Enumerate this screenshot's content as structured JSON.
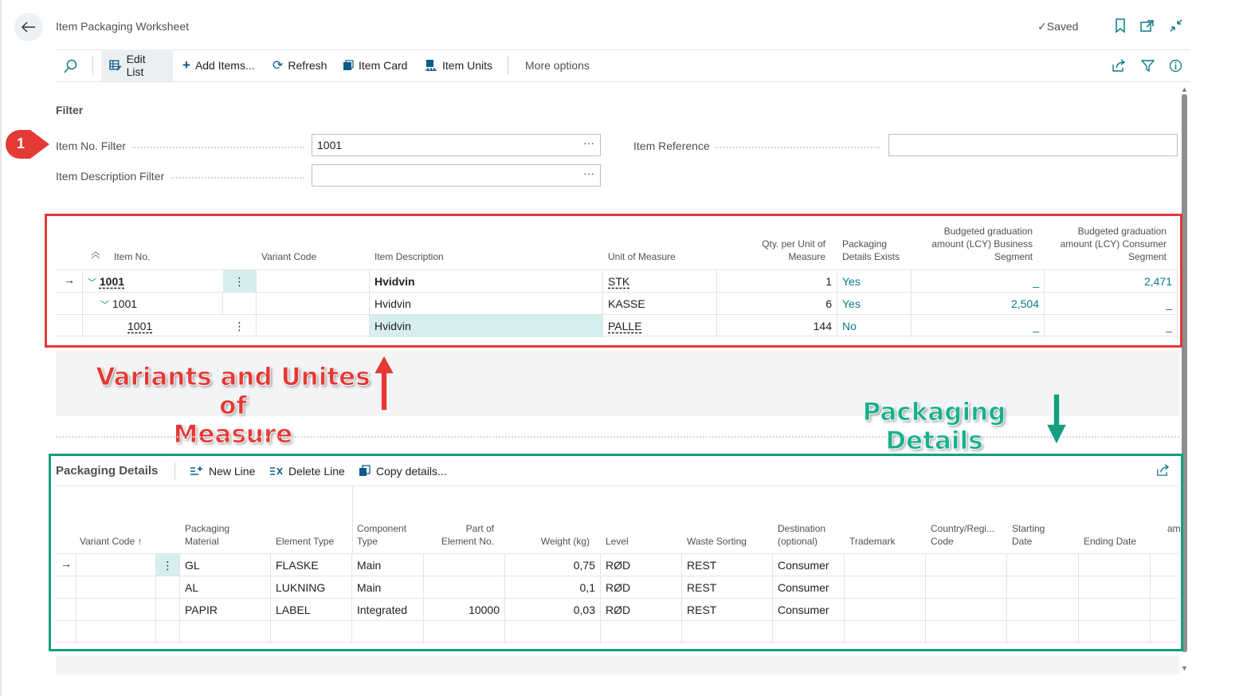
{
  "header": {
    "title": "Item Packaging Worksheet",
    "saved_label": "Saved"
  },
  "actions": {
    "edit_list": "Edit List",
    "add_items": "Add Items...",
    "refresh": "Refresh",
    "item_card": "Item Card",
    "item_units": "Item Units",
    "more_options": "More options"
  },
  "filter": {
    "section_label": "Filter",
    "item_no_label": "Item No. Filter",
    "item_no_value": "1001",
    "item_desc_label": "Item Description Filter",
    "item_desc_value": "",
    "item_ref_label": "Item Reference",
    "item_ref_value": "",
    "ellipsis": "···"
  },
  "badge": {
    "number": "1"
  },
  "item_grid": {
    "headers": {
      "item_no": "Item No.",
      "variant_code": "Variant Code",
      "item_description": "Item Description",
      "unit_of_measure": "Unit of Measure",
      "qty_line1": "Qty. per Unit of",
      "qty_line2": "Measure",
      "pack_line1": "Packaging",
      "pack_line2": "Details Exists",
      "bus_line1": "Budgeted graduation",
      "bus_line2": "amount (LCY) Business",
      "bus_line3": "Segment",
      "con_line1": "Budgeted graduation",
      "con_line2": "amount (LCY) Consumer",
      "con_line3": "Segment"
    },
    "rows": [
      {
        "item_no": "1001",
        "variant": "",
        "description": "Hvidvin",
        "uom": "STK",
        "qty": "1",
        "exists": "Yes",
        "business": "_",
        "consumer": "2,471"
      },
      {
        "item_no": "1001",
        "variant": "",
        "description": "Hvidvin",
        "uom": "KASSE",
        "qty": "6",
        "exists": "Yes",
        "business": "2,504",
        "consumer": "_"
      },
      {
        "item_no": "1001",
        "variant": "",
        "description": "Hvidvin",
        "uom": "PALLE",
        "qty": "144",
        "exists": "No",
        "business": "_",
        "consumer": "_"
      }
    ]
  },
  "annotations": {
    "variants_line1": "Variants and Unites of",
    "variants_line2": "Measure",
    "packaging": "Packaging Details"
  },
  "packaging": {
    "title": "Packaging Details",
    "new_line": "New Line",
    "delete_line": "Delete Line",
    "copy_details": "Copy details...",
    "headers": {
      "variant_code": "Variant Code ↑",
      "material_line1": "Packaging",
      "material_line2": "Material",
      "element_type": "Element Type",
      "component_line1": "Component",
      "component_line2": "Type",
      "part_line1": "Part of",
      "part_line2": "Element No.",
      "weight": "Weight (kg)",
      "level": "Level",
      "waste": "Waste Sorting",
      "dest_line1": "Destination",
      "dest_line2": "(optional)",
      "trademark": "Trademark",
      "country_line1": "Country/Regi...",
      "country_line2": "Code",
      "start_line1": "Starting",
      "start_line2": "Date",
      "ending": "Ending Date",
      "cut": "am"
    },
    "rows": [
      {
        "variant": "",
        "material": "GL",
        "element_type": "FLASKE",
        "component": "Main",
        "part_of": "",
        "weight": "0,75",
        "level": "RØD",
        "waste": "REST",
        "destination": "Consumer"
      },
      {
        "variant": "",
        "material": "AL",
        "element_type": "LUKNING",
        "component": "Main",
        "part_of": "",
        "weight": "0,1",
        "level": "RØD",
        "waste": "REST",
        "destination": "Consumer"
      },
      {
        "variant": "",
        "material": "PAPIR",
        "element_type": "LABEL",
        "component": "Integrated",
        "part_of": "10000",
        "weight": "0,03",
        "level": "RØD",
        "waste": "REST",
        "destination": "Consumer"
      }
    ]
  },
  "colors": {
    "accent": "#0a7a8a",
    "red_annotation": "#e53935",
    "green_annotation": "#139e80"
  },
  "icons": [
    "back-arrow-icon",
    "checkmark-icon",
    "bookmark-icon",
    "open-new-icon",
    "collapse-icon",
    "search-icon",
    "edit-list-icon",
    "plus-icon",
    "refresh-icon",
    "item-card-icon",
    "item-units-icon",
    "share-icon",
    "filter-icon",
    "info-icon",
    "row-arrow-icon",
    "chevron-down-icon",
    "sort-up-icon",
    "more-vertical-icon",
    "new-line-icon",
    "delete-line-icon",
    "copy-icon",
    "red-arrow-up-icon",
    "green-arrow-down-icon"
  ]
}
